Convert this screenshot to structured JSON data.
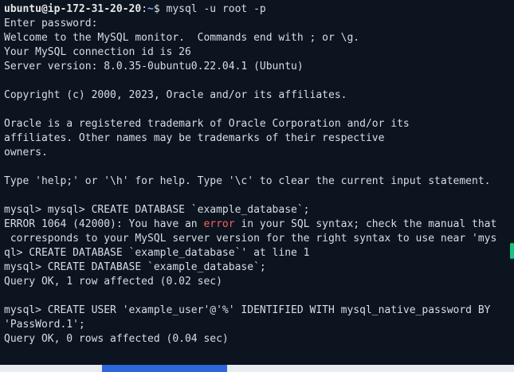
{
  "terminal": {
    "prompt_user": "ubuntu@ip-172-31-20-20",
    "prompt_sep": ":",
    "prompt_path": "~",
    "prompt_symbol": "$",
    "prompt_command": " mysql -u root -p",
    "lines": [
      "Enter password:",
      "Welcome to the MySQL monitor.  Commands end with ; or \\g.",
      "Your MySQL connection id is 26",
      "Server version: 8.0.35-0ubuntu0.22.04.1 (Ubuntu)",
      "",
      "Copyright (c) 2000, 2023, Oracle and/or its affiliates.",
      "",
      "Oracle is a registered trademark of Oracle Corporation and/or its",
      "affiliates. Other names may be trademarks of their respective",
      "owners.",
      "",
      "Type 'help;' or '\\h' for help. Type '\\c' to clear the current input statement.",
      "",
      "mysql> mysql> CREATE DATABASE `example_database`;"
    ],
    "error_prefix": "ERROR 1064 (42000): You have an ",
    "error_word": "error",
    "error_suffix": " in your SQL syntax; check the manual that",
    "lines_after": [
      " corresponds to your MySQL server version for the right syntax to use near 'mys",
      "ql> CREATE DATABASE `example_database`' at line 1",
      "mysql> CREATE DATABASE `example_database`;",
      "Query OK, 1 row affected (0.02 sec)",
      "",
      "mysql> CREATE USER 'example_user'@'%' IDENTIFIED WITH mysql_native_password BY",
      "'PassWord.1';",
      "Query OK, 0 rows affected (0.04 sec)"
    ]
  },
  "colors": {
    "background": "#0c1420",
    "text": "#d6dde5",
    "path": "#7ea7ff",
    "error": "#ff5f5f",
    "scrollbar": "#19c37d",
    "taskbar_button": "#2d66d8"
  }
}
